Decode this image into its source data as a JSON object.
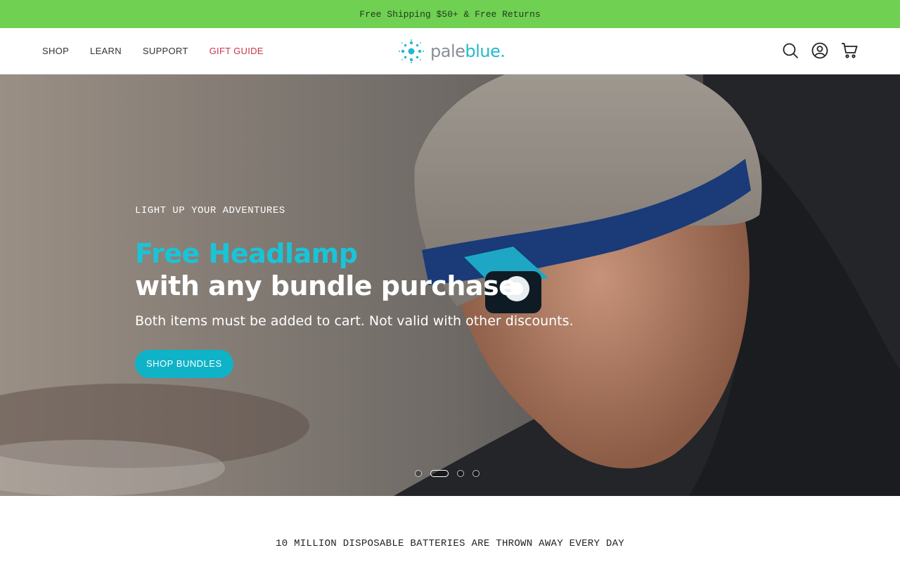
{
  "announcement": {
    "text": "Free Shipping $50+ & Free Returns"
  },
  "nav": {
    "items": [
      {
        "label": "SHOP"
      },
      {
        "label": "LEARN"
      },
      {
        "label": "SUPPORT"
      },
      {
        "label": "GIFT GUIDE"
      }
    ]
  },
  "logo": {
    "pale": "pale",
    "blue": "blue",
    "dot": "."
  },
  "header_icons": [
    "search-icon",
    "account-icon",
    "cart-icon"
  ],
  "hero": {
    "eyebrow": "LIGHT UP YOUR ADVENTURES",
    "headline_1": "Free Headlamp",
    "headline_2": "with any bundle purchase",
    "subtext": "Both items must be added to cart. Not valid with other discounts.",
    "cta_label": "SHOP BUNDLES",
    "slides_count": 4,
    "active_slide": 2
  },
  "tagline": "10 MILLION DISPOSABLE BATTERIES ARE THROWN AWAY EVERY DAY",
  "colors": {
    "announcement_bg": "#6fd052",
    "accent": "#19c4d8",
    "cta_bg": "#0fb3c8",
    "gift_guide": "#c8364c"
  }
}
